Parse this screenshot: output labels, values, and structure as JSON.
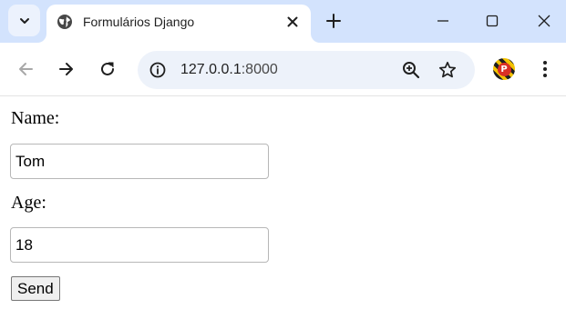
{
  "browser": {
    "tab": {
      "title": "Formulários Django",
      "favicon": "globe-icon"
    },
    "address_bar": {
      "host": "127.0.0.1",
      "port": ":8000"
    },
    "profile_letter": "P",
    "colors": {
      "tabstrip": "#d3e3fd",
      "omnibox": "#edf2fa",
      "profile_badge": "#d93025"
    }
  },
  "form": {
    "name_label": "Name:",
    "name_value": "Tom",
    "age_label": "Age:",
    "age_value": "18",
    "send_label": "Send"
  }
}
